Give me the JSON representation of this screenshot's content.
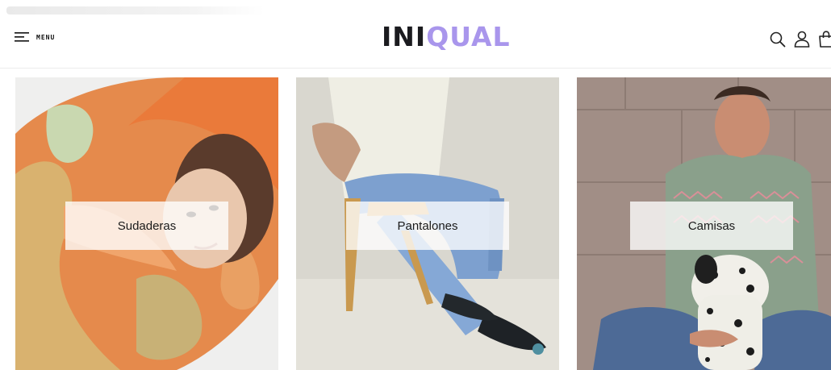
{
  "header": {
    "menu_label": "MENU",
    "logo_part1": "INI",
    "logo_part2": "QUAL",
    "logo_accent_color": "#a996ec",
    "icons": [
      "search-icon",
      "user-icon",
      "bag-icon"
    ]
  },
  "categories": [
    {
      "label": "Sudaderas"
    },
    {
      "label": "Pantalones"
    },
    {
      "label": "Camisas"
    }
  ]
}
